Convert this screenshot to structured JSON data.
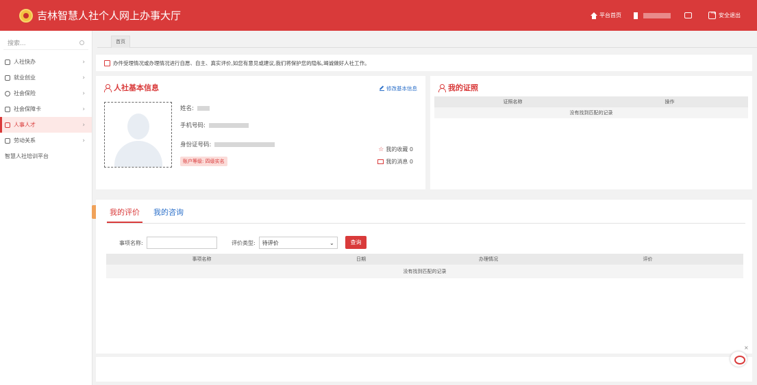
{
  "header": {
    "title": "吉林智慧人社个人网上办事大厅",
    "home_label": "平台首页",
    "logout_label": "安全退出"
  },
  "sidebar": {
    "search_placeholder": "搜索...",
    "items": [
      {
        "label": "人社快办"
      },
      {
        "label": "就业创业"
      },
      {
        "label": "社会保险"
      },
      {
        "label": "社会保障卡"
      },
      {
        "label": "人事人才"
      },
      {
        "label": "劳动关系"
      },
      {
        "label": "智慧人社培训平台"
      }
    ],
    "active_index": 4
  },
  "tabbar": {
    "home_tab": "首页"
  },
  "notice": {
    "text": "办件受理情况或办理情况进行自愿、自主、真实评价,如您有意见或建议,我们将保护您的隐私,竭诚做好人社工作。"
  },
  "basic_info": {
    "title": "人社基本信息",
    "edit_label": "修改基本信息",
    "name_label": "姓名:",
    "phone_label": "手机号码:",
    "id_label": "身份证号码:",
    "account_level": "账户等级: 四级实名",
    "favorites": "我的收藏 0",
    "messages": "我的消息 0"
  },
  "certificates": {
    "title": "我的证照",
    "columns": [
      "证照名称",
      "操作"
    ],
    "empty": "没有找到匹配的记录"
  },
  "evaluation": {
    "tabs": [
      "我的评价",
      "我的咨询"
    ],
    "item_label": "事项名称:",
    "type_label": "评价类型:",
    "type_value": "待评价",
    "query_label": "查询",
    "columns": [
      "事项名称",
      "日期",
      "办理情况",
      "评价"
    ],
    "empty": "没有找到匹配的记录"
  },
  "float": {
    "close": "×"
  },
  "colors": {
    "brand": "#d93a3a",
    "link": "#2b6fc9"
  }
}
